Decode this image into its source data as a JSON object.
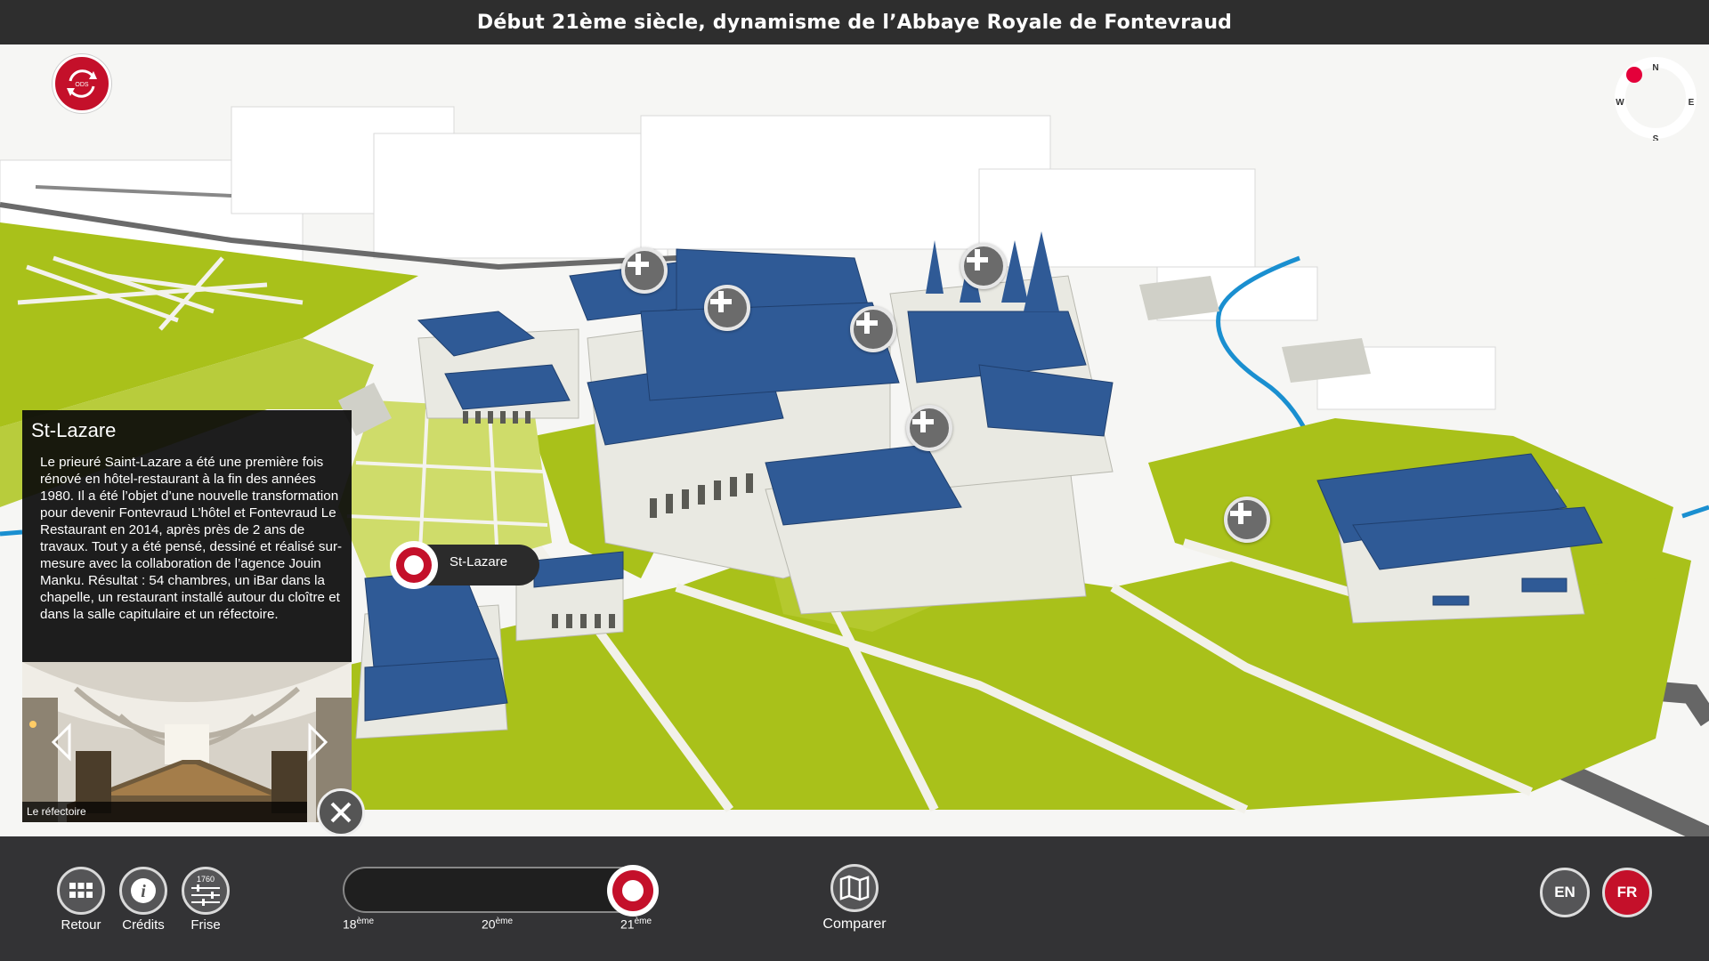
{
  "header": {
    "title": "Début 21ème siècle, dynamisme de l’Abbaye Royale de Fontevraud"
  },
  "logo": {
    "text": "ODS",
    "icon": "refresh-icon"
  },
  "compass": {
    "n": "N",
    "e": "E",
    "s": "S",
    "w": "W"
  },
  "map_markers": [
    {
      "name": "plus-marker",
      "icon": "plus-icon"
    }
  ],
  "poi": {
    "label": "St-Lazare"
  },
  "info_panel": {
    "title": "St-Lazare",
    "text": "Le prieuré Saint-Lazare a été une première fois rénové en hôtel-restaurant à la fin des années 1980. Il a été l’objet d’une nouvelle transformation pour devenir Fontevraud L’hôtel et Fontevraud Le Restaurant en 2014, après près de 2 ans de travaux. Tout y a été pensé, dessiné et réalisé sur-mesure avec la collaboration de l’agence Jouin Manku. Résultat : 54 chambres, un iBar dans la chapelle, un restaurant installé autour du cloître et dans la salle capitulaire et un réfectoire.",
    "image_caption": "Le réfectoire"
  },
  "toolbar": {
    "retour": "Retour",
    "credits": "Crédits",
    "frise": "Frise",
    "frise_year": "1760",
    "comparer": "Comparer"
  },
  "timeline": {
    "ticks": [
      {
        "base": "18",
        "sup": "ème"
      },
      {
        "base": "20",
        "sup": "ème"
      },
      {
        "base": "21",
        "sup": "ème"
      }
    ],
    "selected_index": 2
  },
  "languages": {
    "en": "EN",
    "fr": "FR",
    "active": "FR"
  },
  "colors": {
    "accent": "#c4102a",
    "roof": "#2f5a96",
    "lawn": "#a9c11a",
    "bar": "#333335",
    "river": "#1a8fd0"
  }
}
